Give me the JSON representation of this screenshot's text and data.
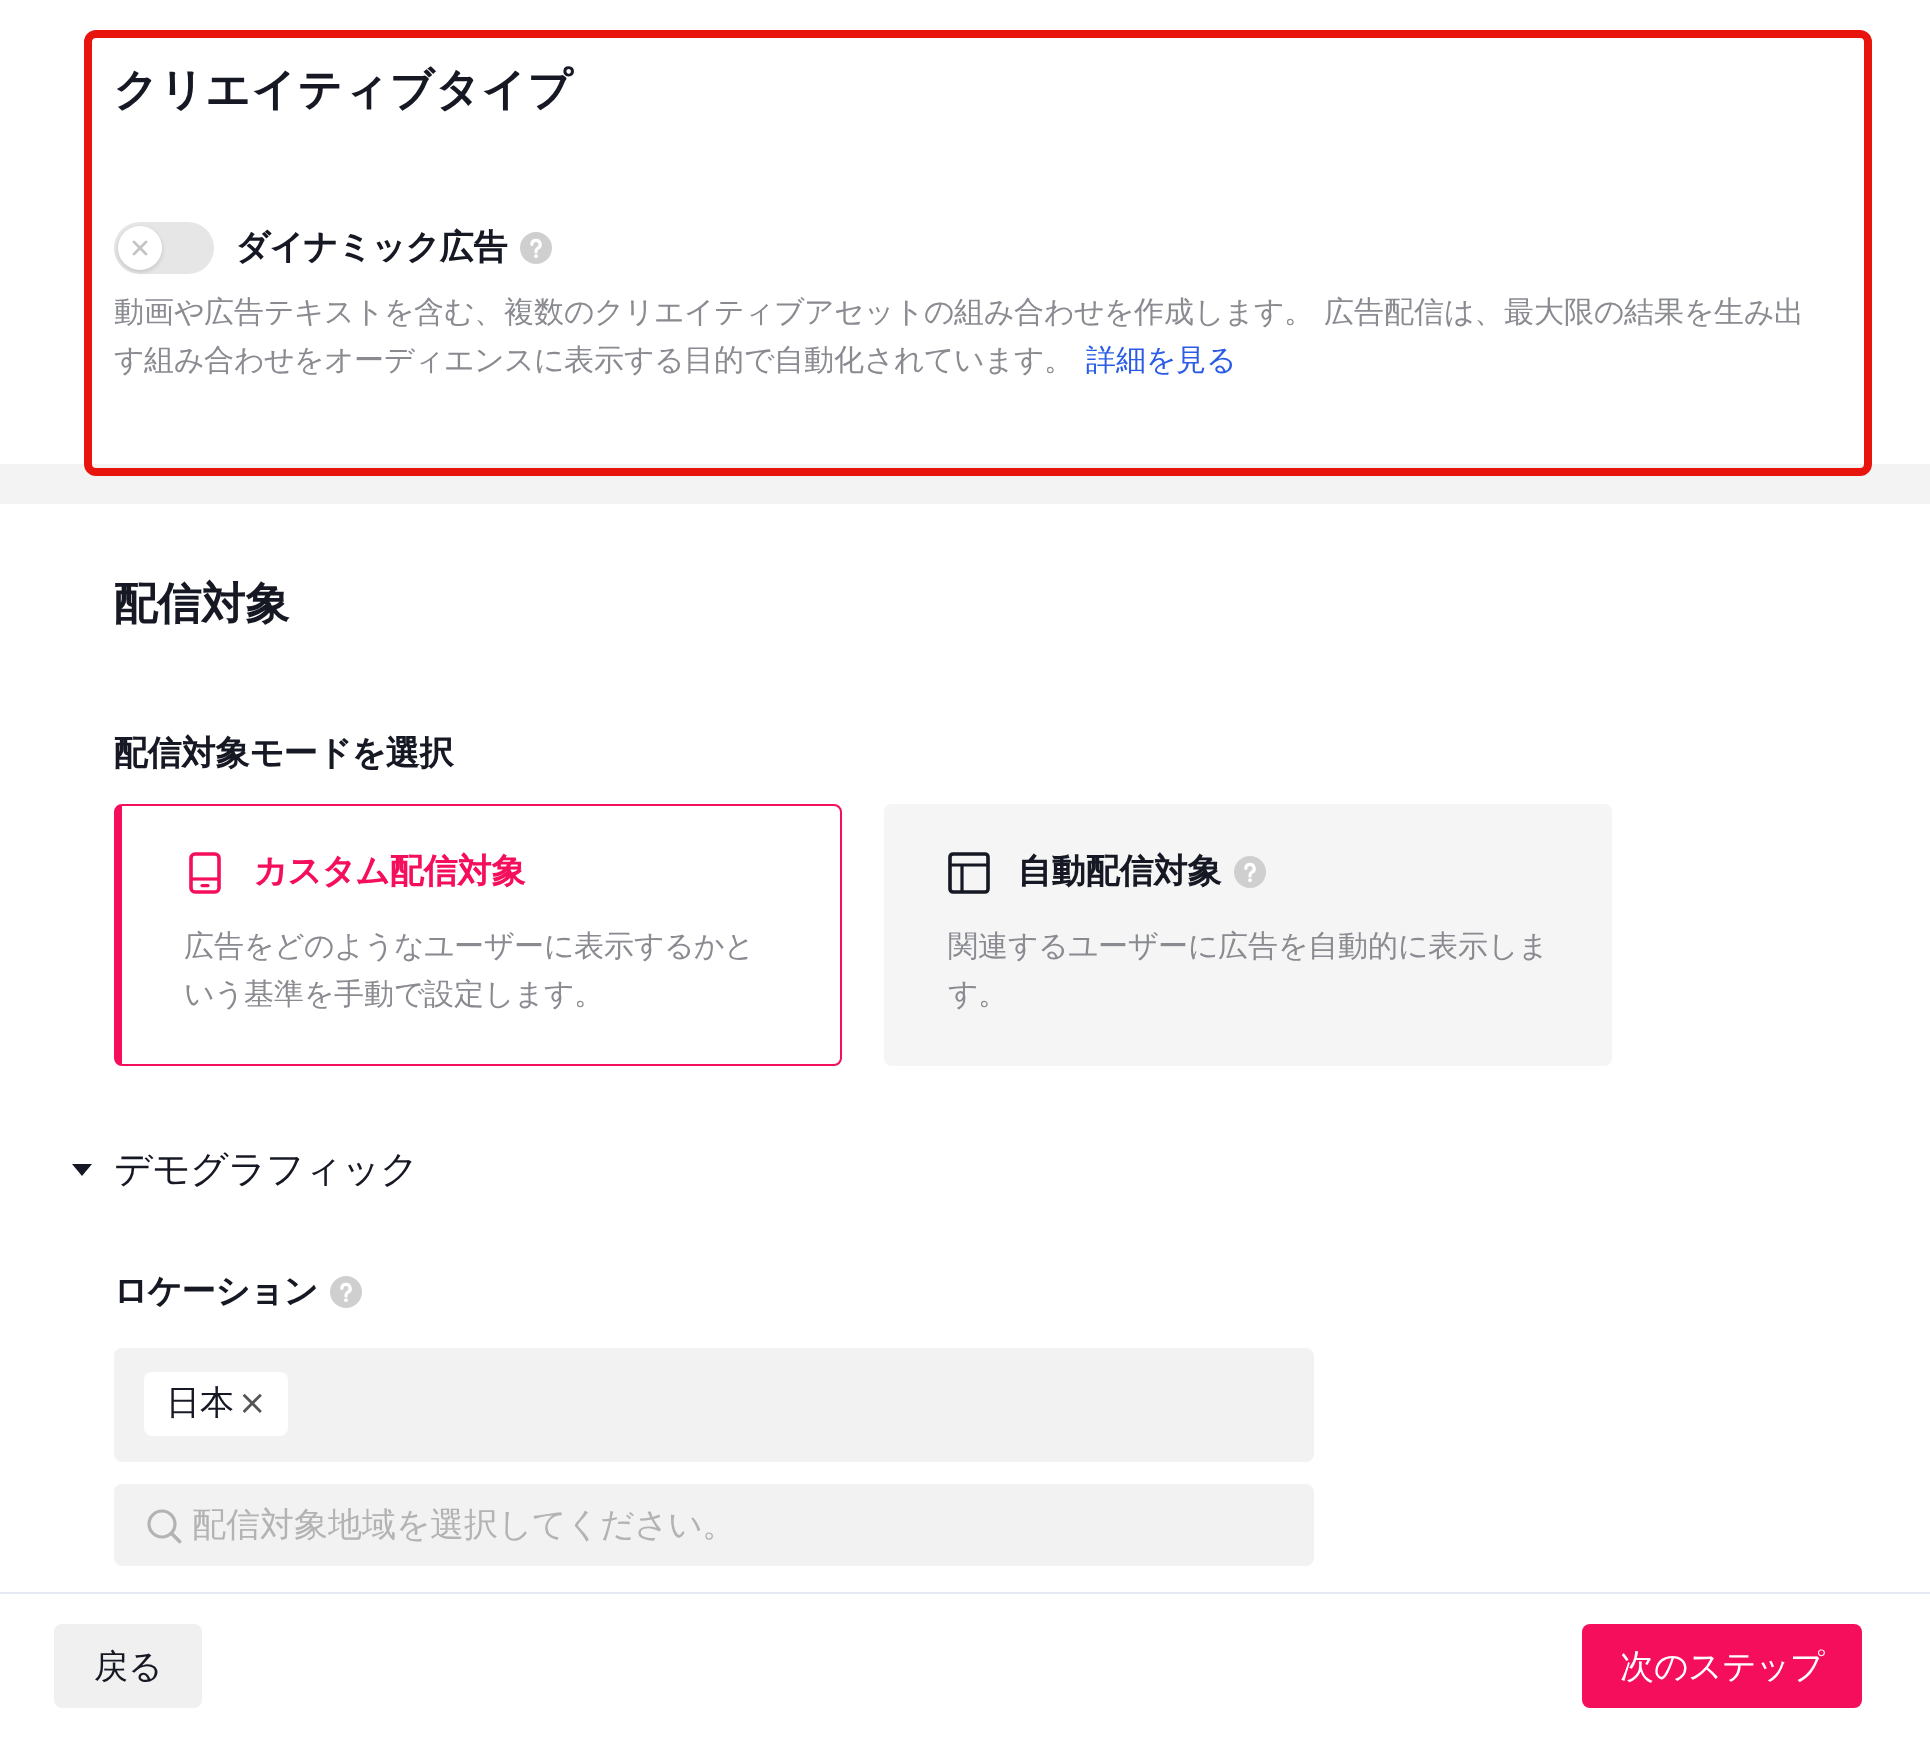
{
  "creative_type": {
    "title": "クリエイティブタイプ",
    "highlighted": true,
    "dynamic_ad": {
      "label": "ダイナミック広告",
      "on": false,
      "description": "動画や広告テキストを含む、複数のクリエイティブアセットの組み合わせを作成します。 広告配信は、最大限の結果を生み出す組み合わせをオーディエンスに表示する目的で自動化されています。",
      "link": "詳細を見る"
    }
  },
  "audience": {
    "title": "配信対象",
    "mode_label": "配信対象モードを選択",
    "modes": [
      {
        "kind": "custom",
        "title": "カスタム配信対象",
        "description": "広告をどのようなユーザーに表示するかという基準を手動で設定します。",
        "help": false,
        "selected": true
      },
      {
        "kind": "automatic",
        "title": "自動配信対象",
        "description": "関連するユーザーに広告を自動的に表示します。",
        "help": true,
        "selected": false
      }
    ],
    "demographics": {
      "title": "デモグラフィック",
      "expanded": true,
      "location": {
        "label": "ロケーション",
        "tags": [
          {
            "label": "日本",
            "remove": "×"
          }
        ],
        "search": {
          "placeholder": "配信対象地域を選択してください。"
        }
      }
    }
  },
  "footer": {
    "buttons": [
      {
        "kind": "secondary",
        "label": "戻る"
      },
      {
        "kind": "primary",
        "label": "次のステップ"
      }
    ]
  }
}
